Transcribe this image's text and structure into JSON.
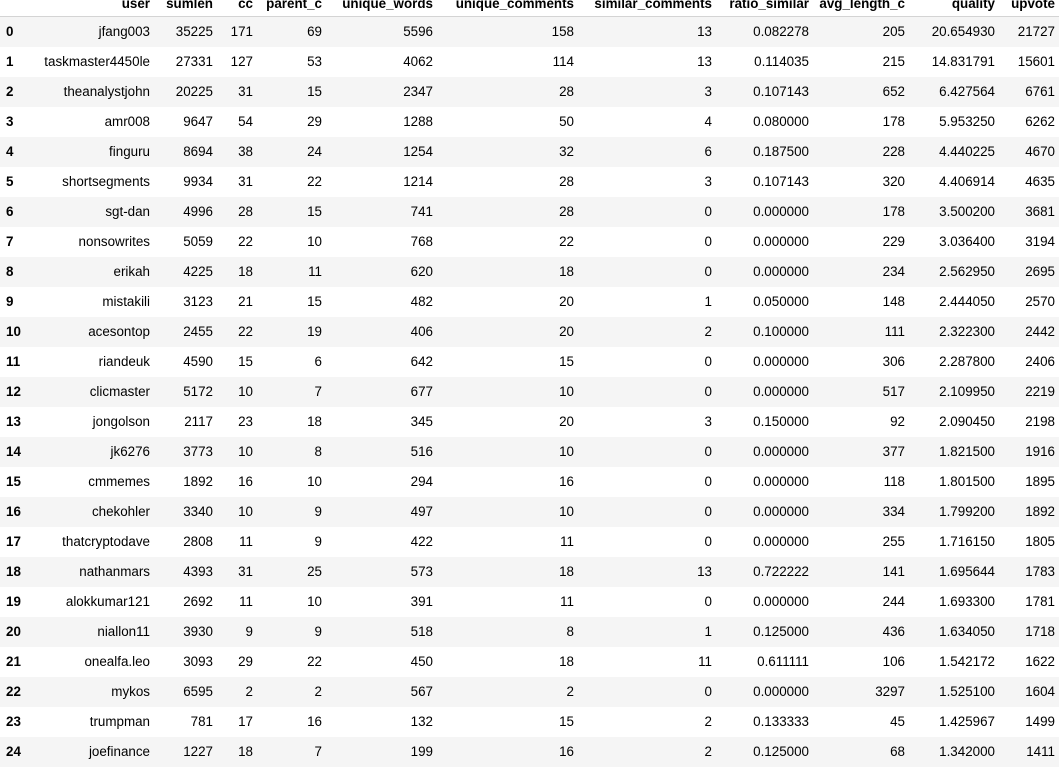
{
  "table": {
    "columns": [
      "",
      "user",
      "sumlen",
      "cc",
      "parent_c",
      "unique_words",
      "unique_comments",
      "similar_comments",
      "ratio_similar",
      "avg_length_c",
      "quality",
      "upvote"
    ],
    "rows": [
      [
        "0",
        "jfang003",
        "35225",
        "171",
        "69",
        "5596",
        "158",
        "13",
        "0.082278",
        "205",
        "20.654930",
        "21727"
      ],
      [
        "1",
        "taskmaster4450le",
        "27331",
        "127",
        "53",
        "4062",
        "114",
        "13",
        "0.114035",
        "215",
        "14.831791",
        "15601"
      ],
      [
        "2",
        "theanalystjohn",
        "20225",
        "31",
        "15",
        "2347",
        "28",
        "3",
        "0.107143",
        "652",
        "6.427564",
        "6761"
      ],
      [
        "3",
        "amr008",
        "9647",
        "54",
        "29",
        "1288",
        "50",
        "4",
        "0.080000",
        "178",
        "5.953250",
        "6262"
      ],
      [
        "4",
        "finguru",
        "8694",
        "38",
        "24",
        "1254",
        "32",
        "6",
        "0.187500",
        "228",
        "4.440225",
        "4670"
      ],
      [
        "5",
        "shortsegments",
        "9934",
        "31",
        "22",
        "1214",
        "28",
        "3",
        "0.107143",
        "320",
        "4.406914",
        "4635"
      ],
      [
        "6",
        "sgt-dan",
        "4996",
        "28",
        "15",
        "741",
        "28",
        "0",
        "0.000000",
        "178",
        "3.500200",
        "3681"
      ],
      [
        "7",
        "nonsowrites",
        "5059",
        "22",
        "10",
        "768",
        "22",
        "0",
        "0.000000",
        "229",
        "3.036400",
        "3194"
      ],
      [
        "8",
        "erikah",
        "4225",
        "18",
        "11",
        "620",
        "18",
        "0",
        "0.000000",
        "234",
        "2.562950",
        "2695"
      ],
      [
        "9",
        "mistakili",
        "3123",
        "21",
        "15",
        "482",
        "20",
        "1",
        "0.050000",
        "148",
        "2.444050",
        "2570"
      ],
      [
        "10",
        "acesontop",
        "2455",
        "22",
        "19",
        "406",
        "20",
        "2",
        "0.100000",
        "111",
        "2.322300",
        "2442"
      ],
      [
        "11",
        "riandeuk",
        "4590",
        "15",
        "6",
        "642",
        "15",
        "0",
        "0.000000",
        "306",
        "2.287800",
        "2406"
      ],
      [
        "12",
        "clicmaster",
        "5172",
        "10",
        "7",
        "677",
        "10",
        "0",
        "0.000000",
        "517",
        "2.109950",
        "2219"
      ],
      [
        "13",
        "jongolson",
        "2117",
        "23",
        "18",
        "345",
        "20",
        "3",
        "0.150000",
        "92",
        "2.090450",
        "2198"
      ],
      [
        "14",
        "jk6276",
        "3773",
        "10",
        "8",
        "516",
        "10",
        "0",
        "0.000000",
        "377",
        "1.821500",
        "1916"
      ],
      [
        "15",
        "cmmemes",
        "1892",
        "16",
        "10",
        "294",
        "16",
        "0",
        "0.000000",
        "118",
        "1.801500",
        "1895"
      ],
      [
        "16",
        "chekohler",
        "3340",
        "10",
        "9",
        "497",
        "10",
        "0",
        "0.000000",
        "334",
        "1.799200",
        "1892"
      ],
      [
        "17",
        "thatcryptodave",
        "2808",
        "11",
        "9",
        "422",
        "11",
        "0",
        "0.000000",
        "255",
        "1.716150",
        "1805"
      ],
      [
        "18",
        "nathanmars",
        "4393",
        "31",
        "25",
        "573",
        "18",
        "13",
        "0.722222",
        "141",
        "1.695644",
        "1783"
      ],
      [
        "19",
        "alokkumar121",
        "2692",
        "11",
        "10",
        "391",
        "11",
        "0",
        "0.000000",
        "244",
        "1.693300",
        "1781"
      ],
      [
        "20",
        "niallon11",
        "3930",
        "9",
        "9",
        "518",
        "8",
        "1",
        "0.125000",
        "436",
        "1.634050",
        "1718"
      ],
      [
        "21",
        "onealfa.leo",
        "3093",
        "29",
        "22",
        "450",
        "18",
        "11",
        "0.611111",
        "106",
        "1.542172",
        "1622"
      ],
      [
        "22",
        "mykos",
        "6595",
        "2",
        "2",
        "567",
        "2",
        "0",
        "0.000000",
        "3297",
        "1.525100",
        "1604"
      ],
      [
        "23",
        "trumpman",
        "781",
        "17",
        "16",
        "132",
        "15",
        "2",
        "0.133333",
        "45",
        "1.425967",
        "1499"
      ],
      [
        "24",
        "joefinance",
        "1227",
        "18",
        "7",
        "199",
        "16",
        "2",
        "0.125000",
        "68",
        "1.342000",
        "1411"
      ]
    ]
  }
}
